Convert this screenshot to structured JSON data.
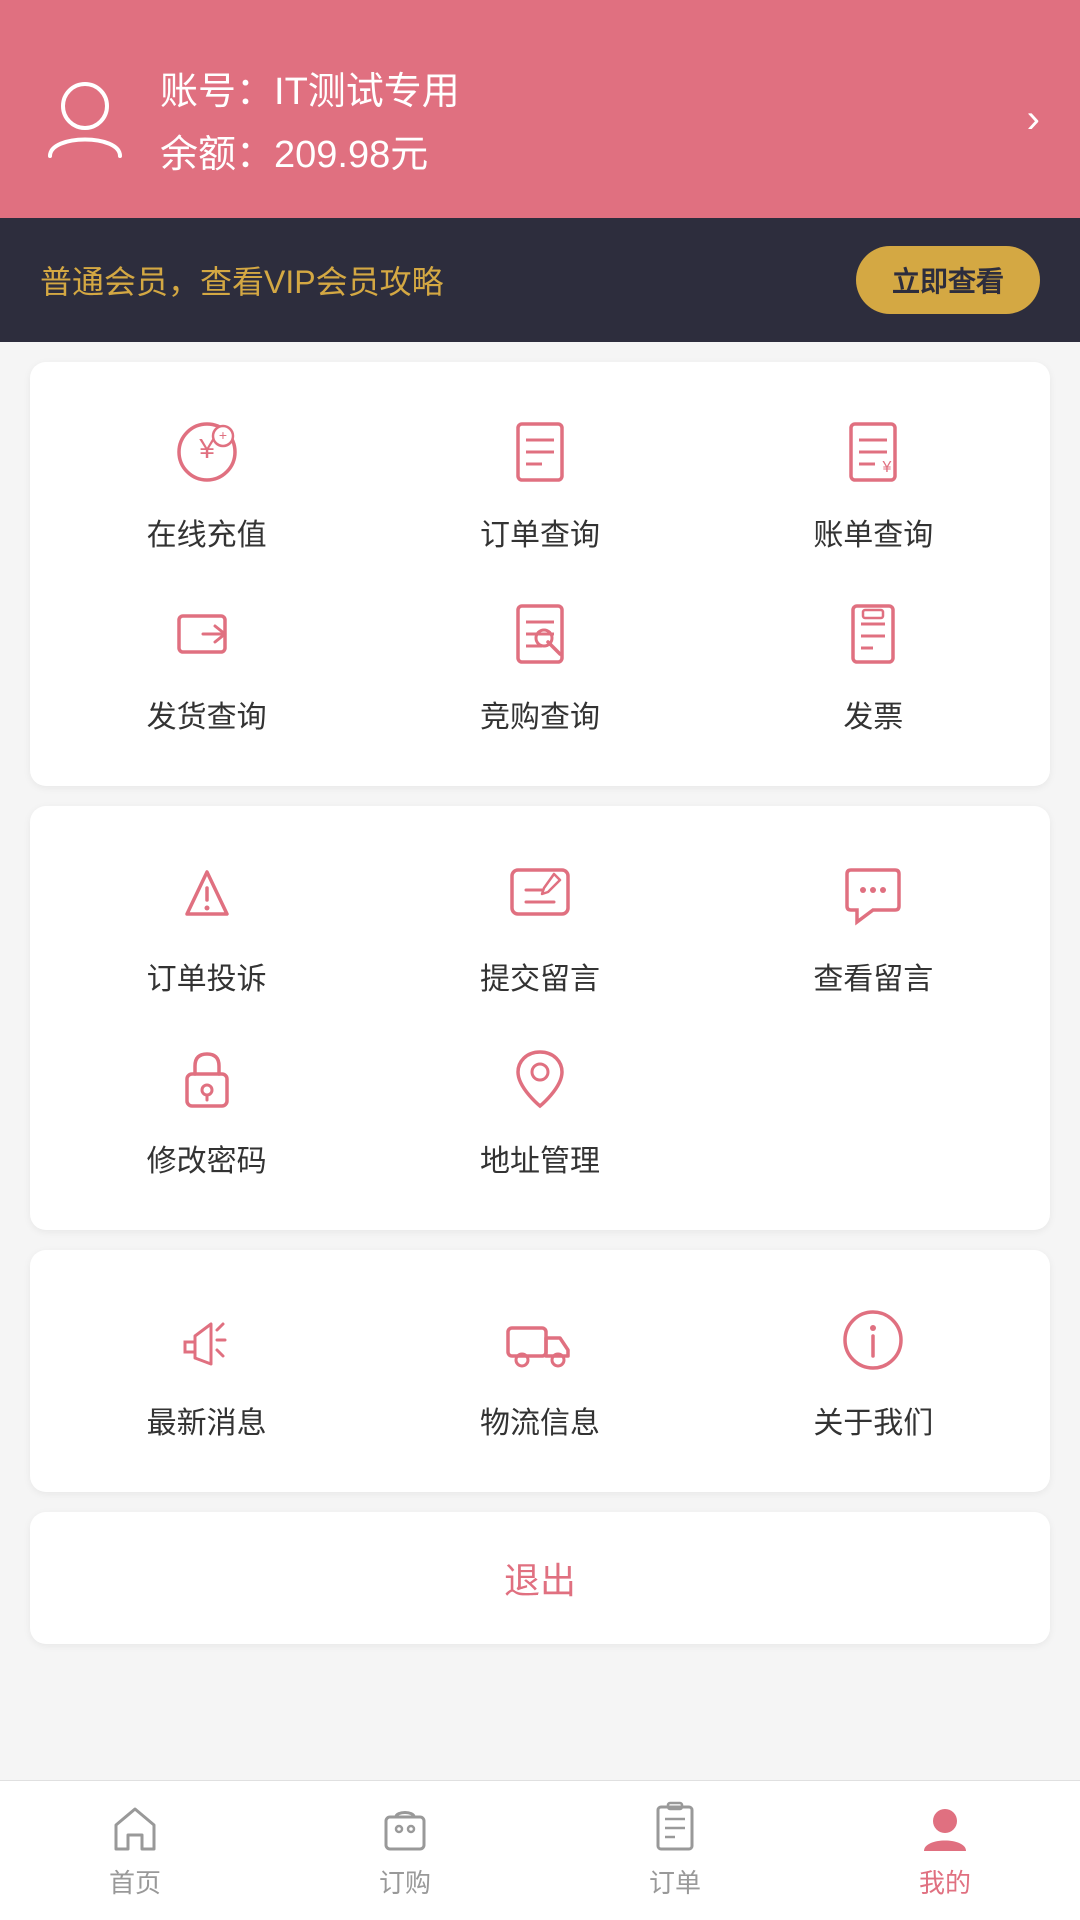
{
  "header": {
    "account_label": "账号：",
    "account_value": "IT测试专用",
    "balance_label": "余额：",
    "balance_value": "209.98元"
  },
  "vip_banner": {
    "text": "普通会员，查看VIP会员攻略",
    "button_label": "立即查看"
  },
  "card1": {
    "row1": [
      {
        "label": "在线充值",
        "icon": "recharge"
      },
      {
        "label": "订单查询",
        "icon": "order-query"
      },
      {
        "label": "账单查询",
        "icon": "bill-query"
      }
    ],
    "row2": [
      {
        "label": "发货查询",
        "icon": "shipping-query"
      },
      {
        "label": "竞购查询",
        "icon": "auction-query"
      },
      {
        "label": "发票",
        "icon": "invoice"
      }
    ]
  },
  "card2": {
    "row1": [
      {
        "label": "订单投诉",
        "icon": "complaint"
      },
      {
        "label": "提交留言",
        "icon": "submit-message"
      },
      {
        "label": "查看留言",
        "icon": "view-message"
      }
    ],
    "row2": [
      {
        "label": "修改密码",
        "icon": "change-password"
      },
      {
        "label": "地址管理",
        "icon": "address"
      },
      {
        "label": "",
        "icon": "empty"
      }
    ]
  },
  "card3": {
    "row1": [
      {
        "label": "最新消息",
        "icon": "notification"
      },
      {
        "label": "物流信息",
        "icon": "logistics"
      },
      {
        "label": "关于我们",
        "icon": "about"
      }
    ]
  },
  "logout": {
    "label": "退出"
  },
  "bottom_nav": {
    "items": [
      {
        "label": "首页",
        "icon": "home",
        "active": false
      },
      {
        "label": "订购",
        "icon": "shop",
        "active": false
      },
      {
        "label": "订单",
        "icon": "orders",
        "active": false
      },
      {
        "label": "我的",
        "icon": "profile",
        "active": true
      }
    ]
  }
}
